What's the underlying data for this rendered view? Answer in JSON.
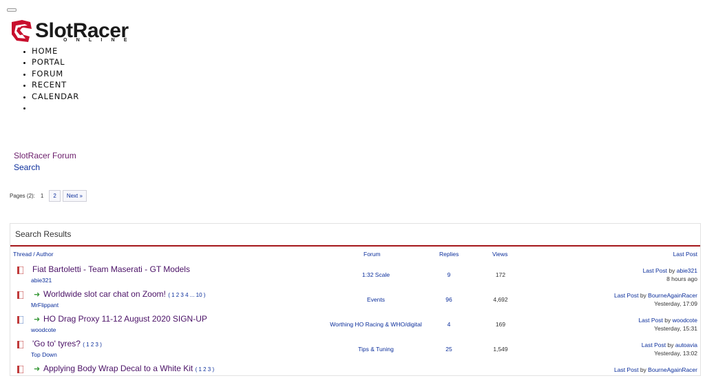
{
  "logo": {
    "word": "SlotRacer",
    "sub": "ONLINE",
    "colors": {
      "red": "#c8102e",
      "dark": "#1a1a1a"
    }
  },
  "nav": {
    "items": [
      "HOME",
      "PORTAL",
      "FORUM",
      "RECENT",
      "CALENDAR",
      ""
    ]
  },
  "breadcrumb": {
    "forum": "SlotRacer Forum",
    "search": "Search"
  },
  "pagination": {
    "label": "Pages (2):",
    "current": "1",
    "page2": "2",
    "next": "Next »"
  },
  "results": {
    "title": "Search Results",
    "columns": {
      "thread": "Thread / Author",
      "forum": "Forum",
      "replies": "Replies",
      "views": "Views",
      "last_post": "Last Post"
    },
    "rows": [
      {
        "title": "Fiat Bartoletti - Team Maserati - GT Models",
        "pages": "",
        "author": "abie321",
        "forum": "1:32 Scale",
        "replies": "9",
        "views": "172",
        "last_label": "Last Post",
        "last_by": "by",
        "last_user": "abie321",
        "last_time": "8 hours ago",
        "moved": false
      },
      {
        "title": "Worldwide slot car chat on Zoom!",
        "pages": "( 1 2 3 4 ... 10 )",
        "author": "MrFlippant",
        "forum": "Events",
        "replies": "96",
        "views": "4,692",
        "last_label": "Last Post",
        "last_by": "by",
        "last_user": "BourneAgainRacer",
        "last_time": "Yesterday, 17:09",
        "moved": true
      },
      {
        "title": "HO Drag Proxy 11-12 August 2020 SIGN-UP",
        "pages": "",
        "author": "woodcote",
        "forum": "Worthing HO Racing & WHO/digital",
        "replies": "4",
        "views": "169",
        "last_label": "Last Post",
        "last_by": "by",
        "last_user": "woodcote",
        "last_time": "Yesterday, 15:31",
        "moved": true
      },
      {
        "title": "'Go to' tyres?",
        "pages": "( 1 2 3 )",
        "author": "Top Down",
        "forum": "Tips & Tuning",
        "replies": "25",
        "views": "1,549",
        "last_label": "Last Post",
        "last_by": "by",
        "last_user": "autoavia",
        "last_time": "Yesterday, 13:02",
        "moved": false
      },
      {
        "title": "Applying Body Wrap Decal to a White Kit",
        "pages": "( 1 2 3 )",
        "author": "",
        "forum": "",
        "replies": "",
        "views": "",
        "last_label": "Last Post",
        "last_by": "by",
        "last_user": "BourneAgainRacer",
        "last_time": "",
        "moved": true
      }
    ]
  }
}
